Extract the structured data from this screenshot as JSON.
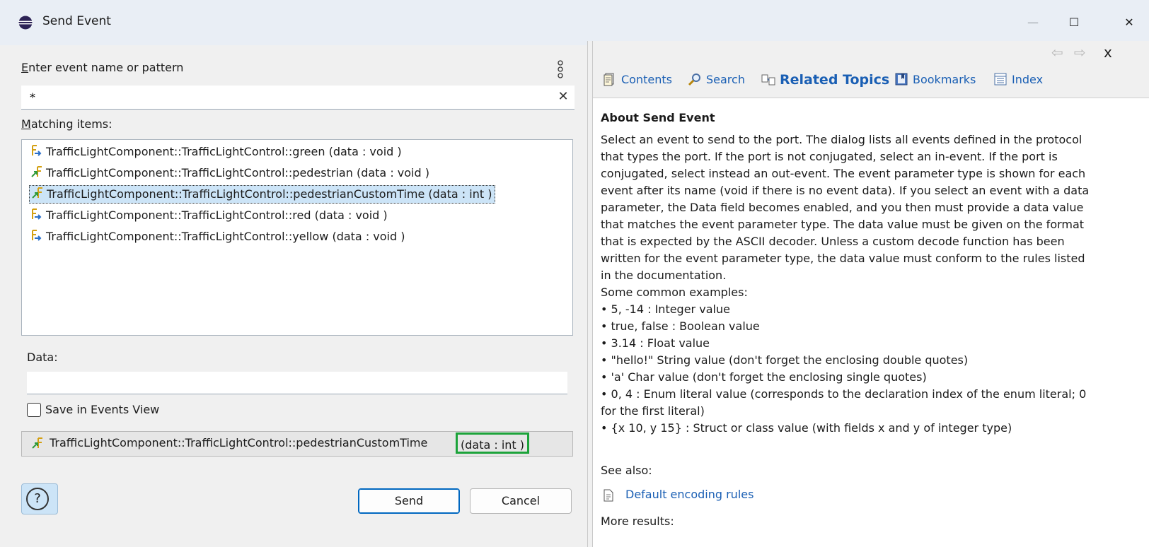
{
  "window": {
    "title": "Send Event",
    "controls": {
      "minimize": "—",
      "maximize": "☐",
      "close": "✕"
    }
  },
  "left": {
    "pattern_label_accel": "E",
    "pattern_label_rest": "nter event name or pattern",
    "pattern_value": "*",
    "clear_glyph": "✕",
    "matching_label_accel": "M",
    "matching_label_rest": "atching items:",
    "items": [
      {
        "label": "TrafficLightComponent::TrafficLightControl::green (data : void )",
        "icon": "in-event-icon",
        "selected": false
      },
      {
        "label": "TrafficLightComponent::TrafficLightControl::pedestrian (data : void )",
        "icon": "out-event-icon",
        "selected": false
      },
      {
        "label": "TrafficLightComponent::TrafficLightControl::pedestrianCustomTime (data : int )",
        "icon": "out-event-icon",
        "selected": true
      },
      {
        "label": "TrafficLightComponent::TrafficLightControl::red (data : void )",
        "icon": "in-event-icon",
        "selected": false
      },
      {
        "label": "TrafficLightComponent::TrafficLightControl::yellow (data : void )",
        "icon": "in-event-icon",
        "selected": false
      }
    ],
    "data_label": "Data:",
    "data_value": "",
    "save_label": "Save in Events View",
    "save_checked": false,
    "status_name": "TrafficLightComponent::TrafficLightControl::pedestrianCustomTime",
    "status_type": "(data : int )",
    "help_glyph": "?",
    "send_label": "Send",
    "cancel_label": "Cancel"
  },
  "help": {
    "nav": {
      "back": "⇦",
      "forward": "⇨",
      "close": "x"
    },
    "tabs": {
      "contents": "Contents",
      "search": "Search",
      "related": "Related Topics",
      "bookmarks": "Bookmarks",
      "index": "Index"
    },
    "heading": "About Send Event",
    "paragraph": "Select an event to send to the port. The dialog lists all events defined in the protocol that types the port. If the port is not conjugated, select an in-event. If the port is conjugated, select instead an out-event. The event parameter type is shown for each event after its name (void if there is no event data). If you select an event with a data parameter, the Data field becomes enabled, and you then must provide a data value that matches the event parameter type. The data value must be given on the format that is expected by the ASCII decoder. Unless a custom decode function has been written for the event parameter type, the data value must conform to the rules listed in the documentation.",
    "examples_intro": "Some common examples:",
    "examples": [
      "5, -14 : Integer value",
      "true, false : Boolean value",
      "3.14 : Float value",
      "\"hello!\" String value (don't forget the enclosing double quotes)",
      "'a' Char value (don't forget the enclosing single quotes)",
      "0, 4 : Enum literal value (corresponds to the declaration index of the enum literal; 0 for the first literal)",
      "{x 10, y 15} : Struct or class value (with fields x and y of integer type)"
    ],
    "see_also": "See also:",
    "default_rules_link": "Default encoding rules",
    "more_results": "More results:"
  },
  "colors": {
    "link": "#1a5fb4",
    "selection": "#cce4f7",
    "highlight_box": "#1ca33a",
    "send_border": "#0067c0"
  }
}
